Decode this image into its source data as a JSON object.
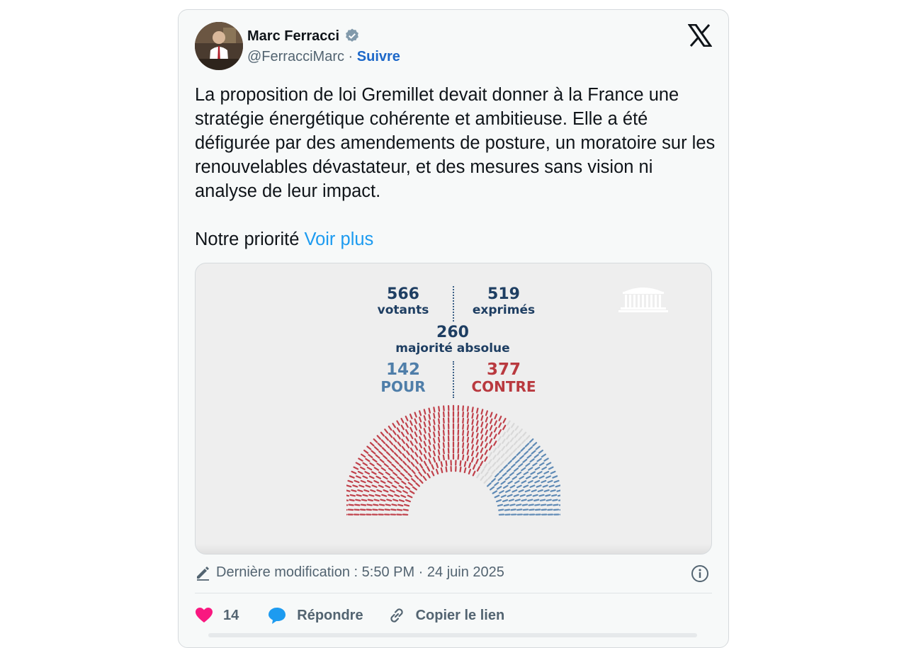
{
  "author": {
    "name": "Marc Ferracci",
    "handle": "@FerracciMarc",
    "separator": "·",
    "follow_label": "Suivre",
    "verified_icon": "verified-badge-icon",
    "avatar_icon": "profile-photo"
  },
  "platform_icon": "x-logo-icon",
  "tweet": {
    "text": "La proposition de loi Gremillet devait donner à la France une stratégie énergétique cohérente et ambitieuse. Elle a été défigurée par des amendements de posture, un moratoire sur les renouvelables dévastateur, et des mesures sans vision ni analyse de leur impact.",
    "text2": "Notre priorité",
    "see_more": "Voir plus"
  },
  "vote_graphic": {
    "votants": {
      "value": "566",
      "label": "votants"
    },
    "exprimes": {
      "value": "519",
      "label": "exprimés"
    },
    "majorite": {
      "value": "260",
      "label": "majorité absolue"
    },
    "pour": {
      "value": "142",
      "label": "POUR"
    },
    "contre": {
      "value": "377",
      "label": "CONTRE"
    },
    "seat_counts": {
      "contre": 377,
      "abstention": 47,
      "pour": 142
    },
    "colors": {
      "contre": "#c0404a",
      "pour": "#5f8ab5",
      "abstention": "#d9d9d9",
      "navy": "#1e3e62",
      "background": "#eeeeee"
    },
    "building_icon": "assemblee-nationale-logo-icon"
  },
  "meta": {
    "edit_icon": "pencil-icon",
    "last_modified": "Dernière modification : 5:50 PM · 24 juin 2025",
    "info_icon": "info-icon"
  },
  "actions": {
    "likes": "14",
    "like_icon": "heart-icon",
    "reply_label": "Répondre",
    "reply_icon": "speech-bubble-icon",
    "copy_label": "Copier le lien",
    "copy_icon": "link-icon"
  },
  "colors": {
    "accent": "#1d9bf0",
    "follow": "#1d68c9",
    "like": "#f91880",
    "text": "#0f1419",
    "muted": "#536471"
  }
}
